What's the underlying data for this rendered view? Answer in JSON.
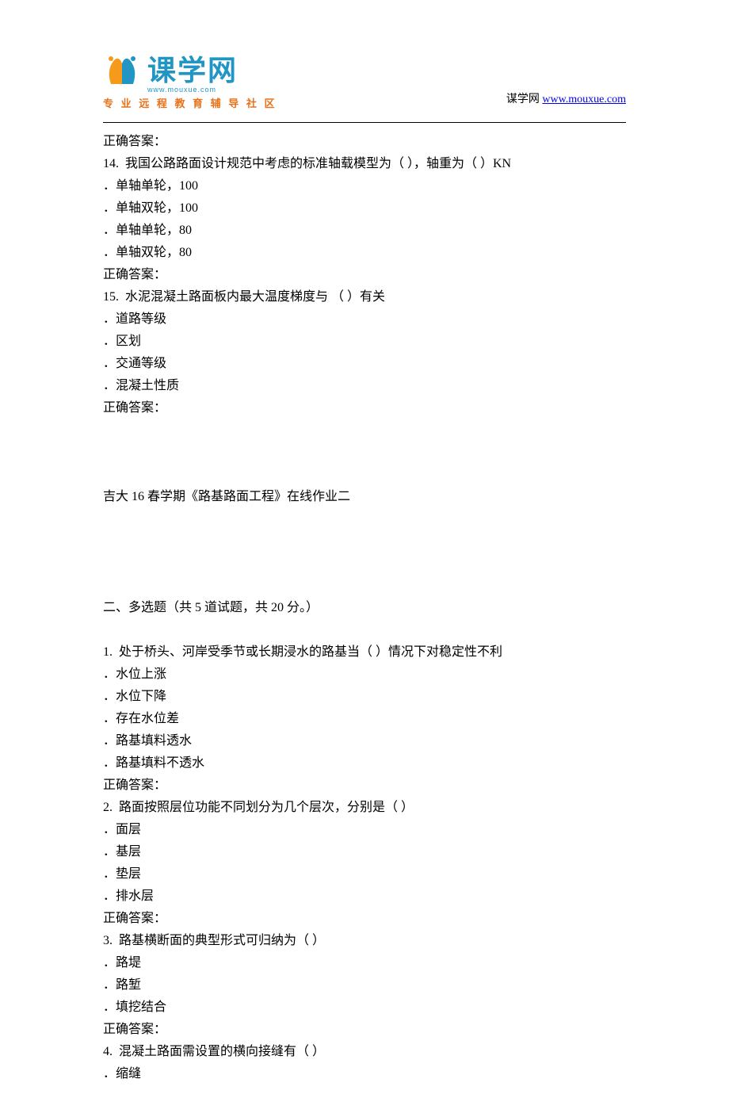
{
  "header": {
    "logo_main": "课学网",
    "logo_url_text": "www.mouxue.com",
    "logo_subtitle": "专 业 远 程 教 育 辅 导 社 区",
    "site_name": "谋学网",
    "site_url": "www.mouxue.com"
  },
  "content": {
    "answer_label": "正确答案：",
    "q14": {
      "number": "14.",
      "text": "我国公路路面设计规范中考虑的标准轴载模型为（ ），轴重为（ ）KN",
      "options": [
        "．单轴单轮，100",
        "．单轴双轮，100",
        "．单轴单轮，80",
        "．单轴双轮，80"
      ]
    },
    "q15": {
      "number": "15.",
      "text": "水泥混凝土路面板内最大温度梯度与 （ ）有关",
      "options": [
        "．道路等级",
        "．区划",
        "．交通等级",
        "．混凝土性质"
      ]
    },
    "section_title": "吉大 16 春学期《路基路面工程》在线作业二",
    "mc_header": "二、多选题（共 5 道试题，共 20 分。）",
    "mc_q1": {
      "number": "1.",
      "text": "处于桥头、河岸受季节或长期浸水的路基当（ ）情况下对稳定性不利",
      "options": [
        "．水位上涨",
        "．水位下降",
        "．存在水位差",
        "．路基填料透水",
        "．路基填料不透水"
      ]
    },
    "mc_q2": {
      "number": "2.",
      "text": "路面按照层位功能不同划分为几个层次，分别是（ ）",
      "options": [
        "．面层",
        "．基层",
        "．垫层",
        "．排水层"
      ]
    },
    "mc_q3": {
      "number": "3.",
      "text": "路基横断面的典型形式可归纳为（ ）",
      "options": [
        "．路堤",
        "．路堑",
        "．填挖结合"
      ]
    },
    "mc_q4": {
      "number": "4.",
      "text": "混凝土路面需设置的横向接缝有（ ）",
      "options": [
        "．缩缝"
      ]
    }
  }
}
